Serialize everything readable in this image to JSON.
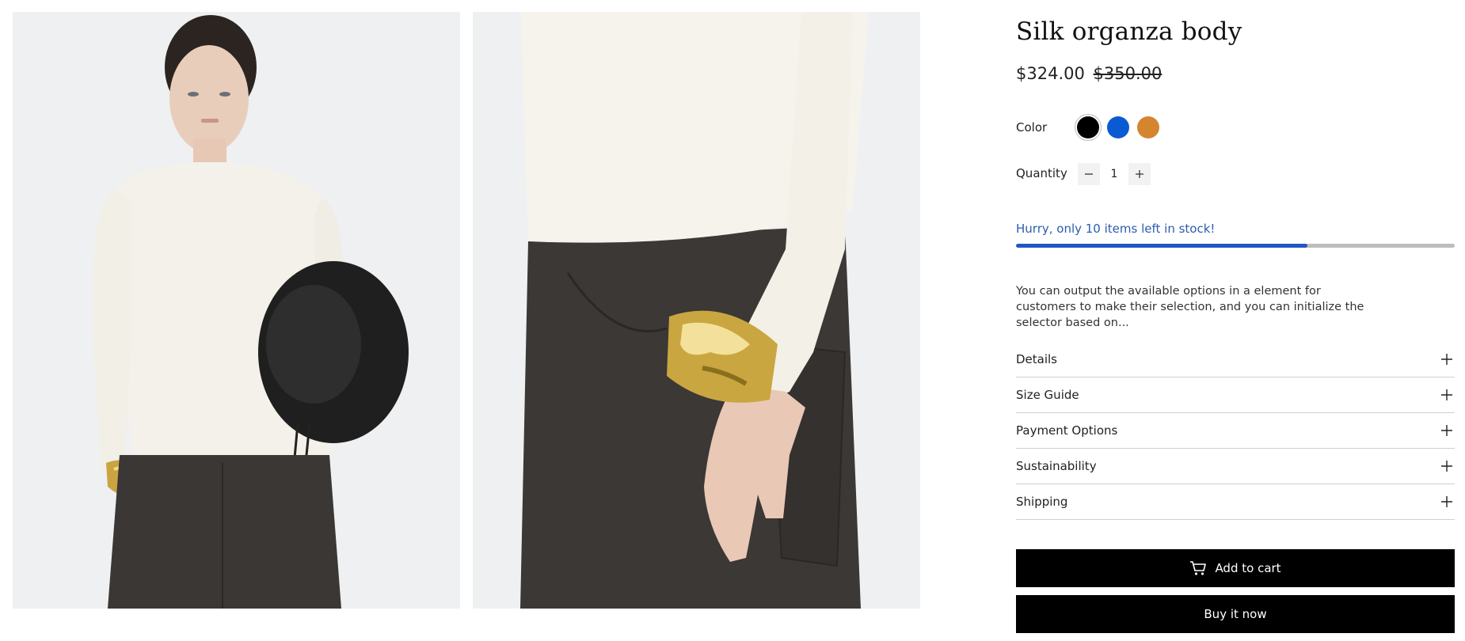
{
  "product": {
    "title": "Silk organza body",
    "price": "$324.00",
    "compare_price": "$350.00"
  },
  "options": {
    "color_label": "Color",
    "colors": [
      {
        "name": "black",
        "hex": "#000000",
        "selected": true
      },
      {
        "name": "blue",
        "hex": "#0a5bd3",
        "selected": false
      },
      {
        "name": "orange",
        "hex": "#d4852e",
        "selected": false
      }
    ],
    "quantity_label": "Quantity",
    "quantity_value": "1",
    "decrement_icon": "minus-icon",
    "increment_icon": "plus-icon"
  },
  "stock": {
    "message": "Hurry, only 10 items left in stock!",
    "progress_fraction": 0.665,
    "bar_color": "#2156c4",
    "message_color": "#2a5db0"
  },
  "description": "You can output the available options in a element for customers to make their selection, and you can initialize the selector based on...",
  "accordion": [
    {
      "label": "Details",
      "icon": "plus-icon"
    },
    {
      "label": "Size Guide",
      "icon": "plus-icon"
    },
    {
      "label": "Payment Options",
      "icon": "plus-icon"
    },
    {
      "label": "Sustainability",
      "icon": "plus-icon"
    },
    {
      "label": "Shipping",
      "icon": "plus-icon"
    }
  ],
  "actions": {
    "add_to_cart": "Add to cart",
    "add_to_cart_icon": "cart-icon",
    "buy_now": "Buy it now"
  },
  "gallery": {
    "images": [
      {
        "subject": "model-front"
      },
      {
        "subject": "model-wrist-detail"
      }
    ]
  }
}
